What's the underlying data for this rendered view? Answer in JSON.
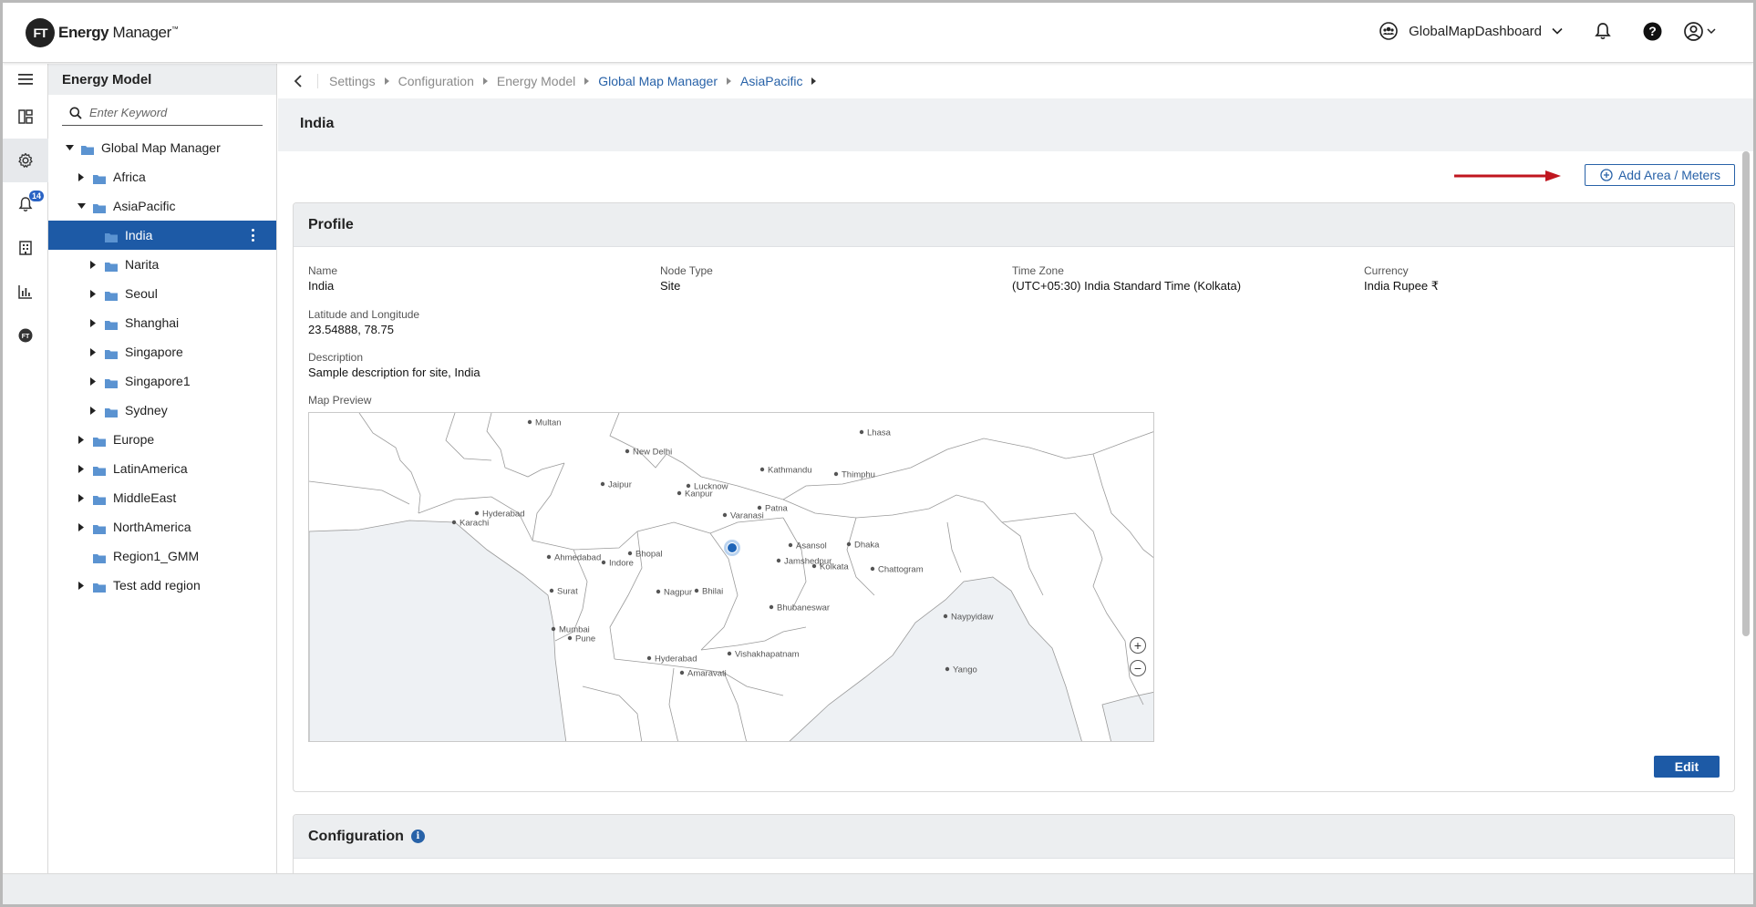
{
  "app": {
    "logo_badge": "FT",
    "logo_name_bold": "Energy",
    "logo_name_rest": " Manager",
    "logo_tm": "™"
  },
  "header": {
    "dashboard_name": "GlobalMapDashboard",
    "icons": [
      "users-icon",
      "chevron-down-icon",
      "bell-icon",
      "help-icon",
      "user-icon"
    ]
  },
  "rail": {
    "items": [
      "menu-icon",
      "dashboard-icon",
      "settings-icon",
      "alerts-icon",
      "building-icon",
      "chart-icon",
      "ft-logo-icon"
    ],
    "alerts_badge": "14"
  },
  "tree": {
    "title": "Energy Model",
    "search_placeholder": "Enter Keyword",
    "items": [
      {
        "label": "Global Map Manager",
        "level": 0,
        "caret": "down"
      },
      {
        "label": "Africa",
        "level": 1,
        "caret": "right"
      },
      {
        "label": "AsiaPacific",
        "level": 1,
        "caret": "down"
      },
      {
        "label": "India",
        "level": 2,
        "caret": "none",
        "selected": true
      },
      {
        "label": "Narita",
        "level": 2,
        "caret": "right"
      },
      {
        "label": "Seoul",
        "level": 2,
        "caret": "right"
      },
      {
        "label": "Shanghai",
        "level": 2,
        "caret": "right"
      },
      {
        "label": "Singapore",
        "level": 2,
        "caret": "right"
      },
      {
        "label": "Singapore1",
        "level": 2,
        "caret": "right"
      },
      {
        "label": "Sydney",
        "level": 2,
        "caret": "right"
      },
      {
        "label": "Europe",
        "level": 1,
        "caret": "right"
      },
      {
        "label": "LatinAmerica",
        "level": 1,
        "caret": "right"
      },
      {
        "label": "MiddleEast",
        "level": 1,
        "caret": "right"
      },
      {
        "label": "NorthAmerica",
        "level": 1,
        "caret": "right"
      },
      {
        "label": "Region1_GMM",
        "level": 1,
        "caret": "none"
      },
      {
        "label": "Test add region",
        "level": 1,
        "caret": "right"
      }
    ]
  },
  "breadcrumb": {
    "items": [
      {
        "label": "Settings",
        "link": false
      },
      {
        "label": "Configuration",
        "link": false
      },
      {
        "label": "Energy Model",
        "link": false
      },
      {
        "label": "Global Map Manager",
        "link": true
      },
      {
        "label": "AsiaPacific",
        "link": true
      }
    ]
  },
  "page": {
    "title": "India",
    "add_button": "Add Area / Meters"
  },
  "profile": {
    "heading": "Profile",
    "name_label": "Name",
    "name_value": "India",
    "node_type_label": "Node Type",
    "node_type_value": "Site",
    "time_zone_label": "Time Zone",
    "time_zone_value": "(UTC+05:30) India Standard Time (Kolkata)",
    "currency_label": "Currency",
    "currency_value": "India Rupee ₹",
    "latlng_label": "Latitude and Longitude",
    "latlng_value": "23.54888, 78.75",
    "description_label": "Description",
    "description_value": "Sample description for site, India",
    "map_label": "Map Preview",
    "edit_button": "Edit"
  },
  "map": {
    "cities": [
      "Multan",
      "New Delhi",
      "Lhasa",
      "Kathmandu",
      "Thimphu",
      "Jaipur",
      "Lucknow",
      "Kanpur",
      "Hyderabad",
      "Karachi",
      "Patna",
      "Varanasi",
      "Asansol",
      "Dhaka",
      "Ahmedabad",
      "Indore",
      "Bhopal",
      "Jamshedpur",
      "Kolkata",
      "Chattogram",
      "Surat",
      "Nagpur",
      "Bhilai",
      "Bhubaneswar",
      "Naypyidaw",
      "Mumbai",
      "Pune",
      "Vishakhapatnam",
      "Hyderabad",
      "Amaravati",
      "Yango"
    ],
    "zoom_in": "+",
    "zoom_out": "−",
    "colors": {
      "land": "#ffffff",
      "water": "#eef1f4",
      "border": "#9a9a9a",
      "marker": "#1f65b8"
    }
  },
  "configuration": {
    "heading": "Configuration",
    "info_icon": "i"
  },
  "colors": {
    "accent": "#1d5aa6",
    "link": "#2862a8",
    "arrow": "#c0161f",
    "badge": "#2a63c4"
  }
}
